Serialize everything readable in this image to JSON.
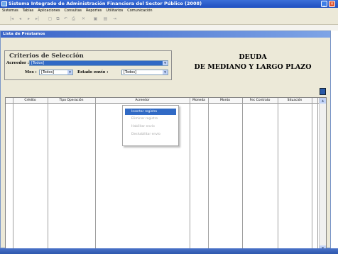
{
  "window": {
    "title": "Sistema Integrado de Administración Financiera del Sector Público (2008)"
  },
  "menu": [
    "Sistemas",
    "Tablas",
    "Aplicaciones",
    "Consultas",
    "Reportes",
    "Utilitarios",
    "Comunicación"
  ],
  "toolbar": {
    "buttons": [
      "first-icon",
      "prev-icon",
      "next-icon",
      "last-icon",
      "new-icon",
      "copy-icon",
      "undo-icon",
      "print-icon",
      "delete-icon",
      "image-icon",
      "save-icon",
      "exit-icon"
    ]
  },
  "form": {
    "title": "Lista de Préstamos"
  },
  "criteria": {
    "title": "Criterios de Selección",
    "acreedor_label": "Acreedor :",
    "acreedor_value": "[Todos]",
    "mes_label": "Mes :",
    "mes_value": "[Todos]",
    "estado_label": "Estado envío :",
    "estado_value": "[Todos]"
  },
  "heading": {
    "line1": "DEUDA",
    "line2": "DE MEDIANO Y LARGO PLAZO"
  },
  "grid": {
    "columns": [
      "Crédito",
      "Tipo Operación",
      "Acreedor",
      "Moneda",
      "Monto",
      "Fec Contrato",
      "Situación"
    ]
  },
  "context_menu": {
    "items": [
      "Insertar registro",
      "Eliminar registro",
      "Habilitar envío",
      "Deshabilitar envío"
    ],
    "active_index": 0
  },
  "colors": {
    "titlebar": "#2a5cc8",
    "selection": "#316ac5",
    "form_bg": "#ece9d8"
  }
}
